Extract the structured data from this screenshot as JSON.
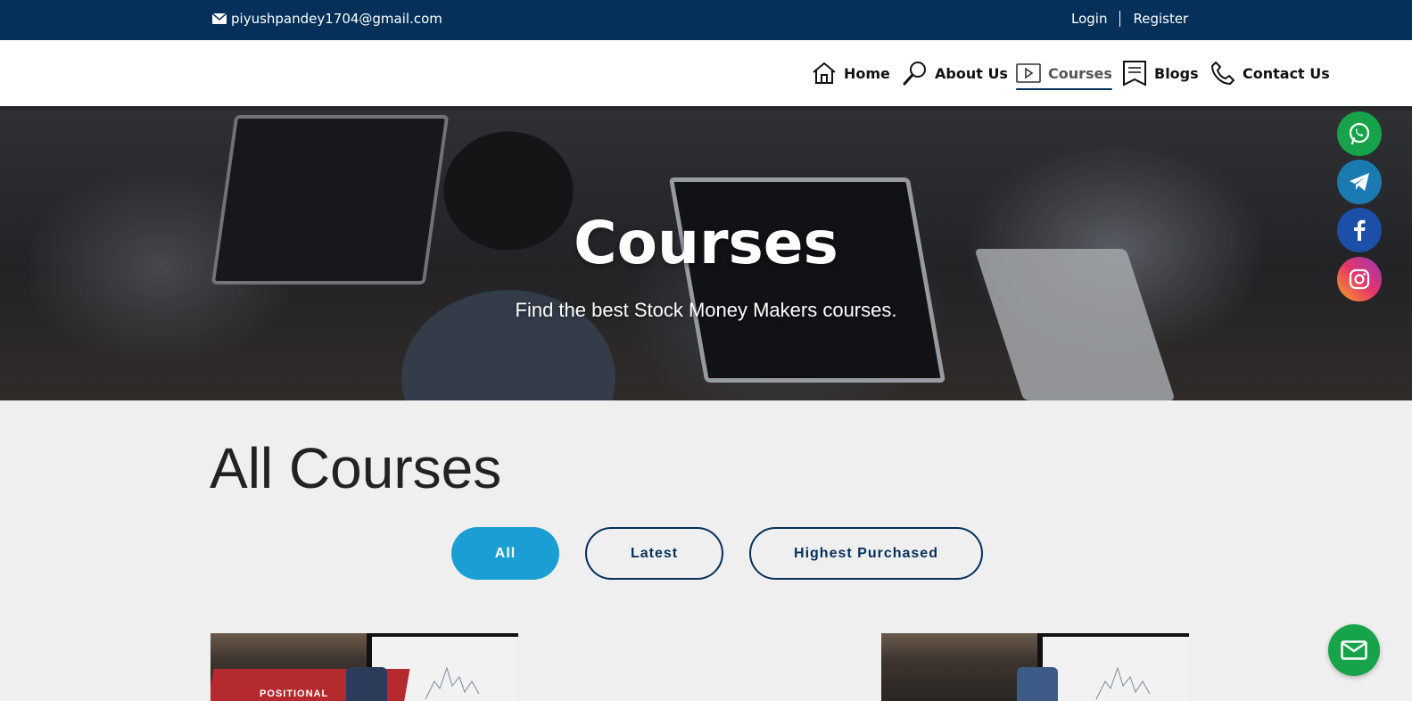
{
  "topbar": {
    "email": "piyushpandey1704@gmail.com",
    "login": "Login",
    "register": "Register"
  },
  "nav": {
    "items": [
      {
        "label": "Home",
        "icon": "home-icon"
      },
      {
        "label": "About Us",
        "icon": "magnifier-icon"
      },
      {
        "label": "Courses",
        "icon": "play-icon",
        "active": true
      },
      {
        "label": "Blogs",
        "icon": "bookmark-icon"
      },
      {
        "label": "Contact Us",
        "icon": "phone-icon"
      }
    ]
  },
  "hero": {
    "title": "Courses",
    "subtitle": "Find the best Stock Money Makers courses."
  },
  "social": [
    {
      "name": "whatsapp-icon",
      "color": "#17a34a"
    },
    {
      "name": "telegram-icon",
      "color": "#1b7ab0"
    },
    {
      "name": "facebook-icon",
      "color": "#1b4fa8"
    },
    {
      "name": "instagram-icon",
      "color": "#d6336c"
    }
  ],
  "section": {
    "title": "All Courses"
  },
  "filters": [
    {
      "label": "All",
      "active": true
    },
    {
      "label": "Latest",
      "active": false
    },
    {
      "label": "Highest Purchased",
      "active": false
    }
  ],
  "cards": [
    {
      "badge": "POSITIONAL"
    },
    {
      "badge": ""
    }
  ],
  "colors": {
    "topbar": "#04305a",
    "accent": "#1a9ed4",
    "background": "#f0eff0"
  }
}
